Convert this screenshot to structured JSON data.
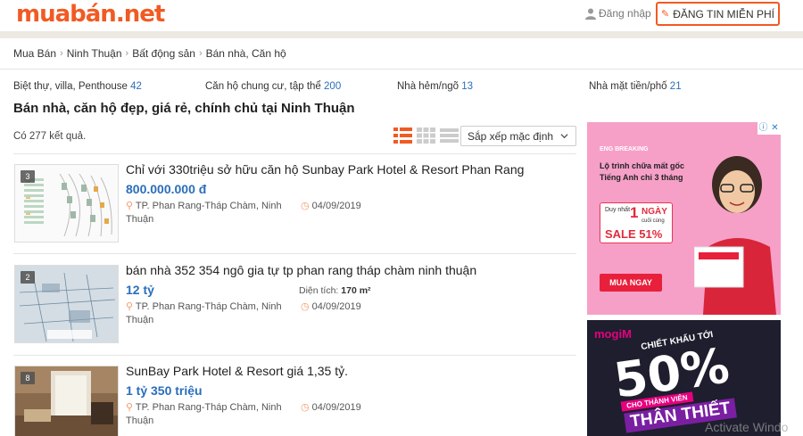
{
  "header": {
    "logo_main": "muabán",
    "logo_dot": ".",
    "logo_tld": "net",
    "login_label": "Đăng nhập",
    "post_button_label": "ĐĂNG TIN MIỄN PHÍ"
  },
  "breadcrumb": [
    "Mua Bán",
    "Ninh Thuận",
    "Bất động sản",
    "Bán nhà, Căn hộ"
  ],
  "categories": [
    {
      "label": "Biệt thự, villa, Penthouse",
      "count": "42"
    },
    {
      "label": "Căn hộ chung cư, tập thể",
      "count": "200"
    },
    {
      "label": "Nhà hẻm/ngõ",
      "count": "13"
    },
    {
      "label": "Nhà mặt tiền/phố",
      "count": "21"
    }
  ],
  "page_title": "Bán nhà, căn hộ đẹp, giá rẻ, chính chủ tại Ninh Thuận",
  "result_count": "Có 277 kết quả.",
  "sort": {
    "selected": "Sắp xếp mặc định"
  },
  "listings": [
    {
      "photo_count": "3",
      "title": "Chỉ với 330triệu sở hữu căn hộ Sunbay Park Hotel & Resort Phan Rang",
      "price": "800.000.000 đ",
      "area_label": "",
      "area_value": "",
      "location": "TP. Phan Rang-Tháp Chàm, Ninh Thuận",
      "date": "04/09/2019"
    },
    {
      "photo_count": "2",
      "title": "bán nhà 352 354 ngô gia tự tp phan rang tháp chàm ninh thuận",
      "price": "12 tỷ",
      "area_label": "Diện tích:",
      "area_value": "170 m²",
      "location": "TP. Phan Rang-Tháp Chàm, Ninh Thuận",
      "date": "04/09/2019"
    },
    {
      "photo_count": "8",
      "title": "SunBay Park Hotel & Resort giá 1,35 tỷ.",
      "price": "1 tỷ 350 triệu",
      "area_label": "",
      "area_value": "",
      "location": "TP. Phan Rang-Tháp Chàm, Ninh Thuận",
      "date": "04/09/2019"
    }
  ],
  "ads": {
    "ad1": {
      "close_i": "ⓘ",
      "close_x": "✕",
      "brand": "ENG BREAKING",
      "headline": "Lộ trình chữa mất gốc Tiếng Anh chỉ 3 tháng",
      "deal_prefix": "Duy nhất",
      "deal_num": "1",
      "deal_unit": "NGÀY",
      "deal_note": "cuối cùng",
      "deal_sale": "SALE 51%",
      "cta": "MUA NGAY"
    },
    "ad2": {
      "brand_a": "mogi",
      "brand_b": "M",
      "chietkhau": "CHIẾT KHẤU TỚI",
      "percent": "50%",
      "ribbon1": "CHO THÀNH VIÊN",
      "ribbon2": "THÂN THIẾT"
    }
  },
  "watermark": "Activate Windo",
  "colors": {
    "brand": "#f15a22",
    "link": "#2a6ebb"
  }
}
